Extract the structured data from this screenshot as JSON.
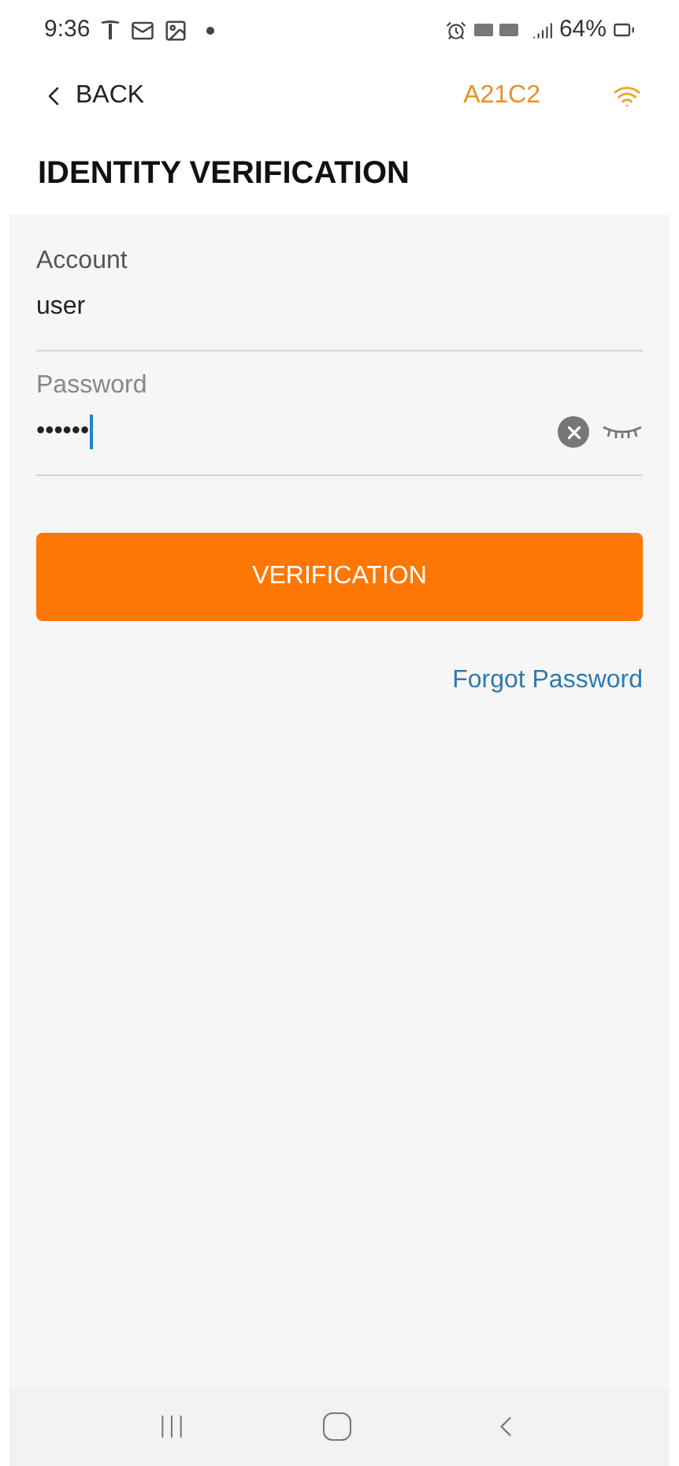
{
  "status_bar": {
    "time": "9:36",
    "battery": "64%"
  },
  "header": {
    "back": "BACK",
    "device": "A21C2"
  },
  "title": "IDENTITY VERIFICATION",
  "fields": [
    {
      "label": "Account",
      "value": "user",
      "focused": false
    },
    {
      "label": "Password",
      "value": "••••••",
      "focused": true
    }
  ],
  "button": "VERIFICATION",
  "link": "Forgot Password"
}
